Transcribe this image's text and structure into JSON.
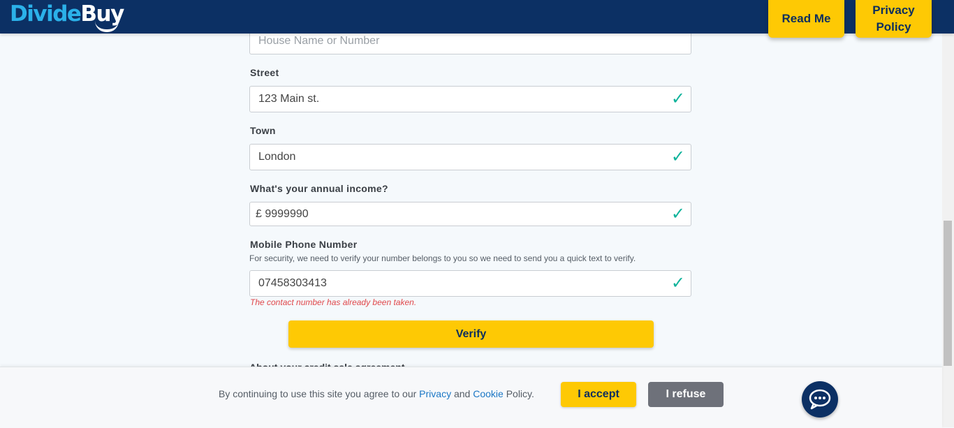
{
  "header": {
    "logo_part1": "Divide",
    "logo_part2": "Buy",
    "read_me": "Read Me",
    "privacy_policy": "Privacy Policy"
  },
  "form": {
    "house": {
      "placeholder": "House Name or Number",
      "value": ""
    },
    "street": {
      "label": "Street",
      "value": "123 Main st."
    },
    "town": {
      "label": "Town",
      "value": "London"
    },
    "income": {
      "label": "What's your annual income?",
      "currency": "£",
      "value": "9999990"
    },
    "phone": {
      "label": "Mobile Phone Number",
      "helper": "For security, we need to verify your number belongs to you so we need to send you a quick text to verify.",
      "value": "07458303413",
      "error": "The contact number has already been taken."
    },
    "verify_label": "Verify",
    "next_section_label": "About your credit sale agreement"
  },
  "cookie_banner": {
    "text_before": "By continuing to use this site you agree to our ",
    "privacy_link": "Privacy",
    "and": " and ",
    "cookie_link": "Cookie",
    "text_after": " Policy.",
    "accept": "I accept",
    "refuse": "I refuse"
  },
  "colors": {
    "header_bg": "#0c3064",
    "accent_yellow": "#fec904",
    "check_green": "#10b39b",
    "error_red": "#e0484b",
    "link_blue": "#1b77c5"
  }
}
